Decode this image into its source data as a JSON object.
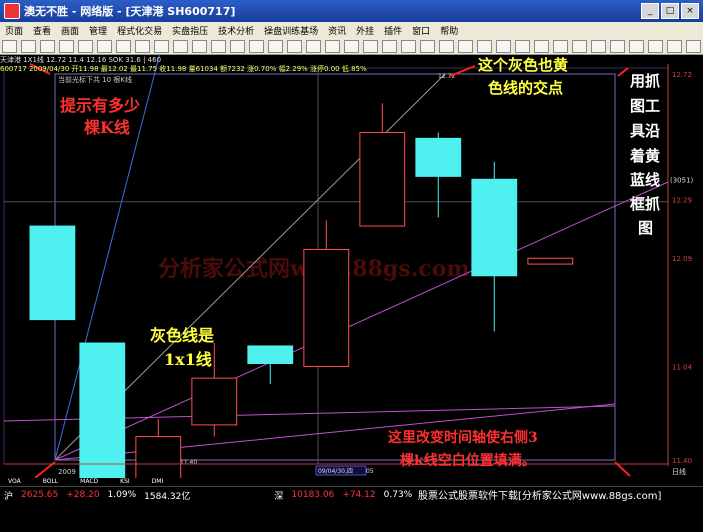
{
  "window": {
    "title": "澳无不胜 - 网络版 - [天津港 SH600717]"
  },
  "menu": [
    "页面",
    "查看",
    "画面",
    "管理",
    "程式化交易",
    "实盘指压",
    "技术分析",
    "操盘训练基场",
    "资讯",
    "外挂",
    "插件",
    "窗口",
    "帮助"
  ],
  "toolbar_icons": [
    "a",
    "b",
    "c",
    "d",
    "e",
    "f",
    "g",
    "h",
    "i",
    "j",
    "k",
    "l",
    "m",
    "n",
    "o",
    "p",
    "q",
    "r",
    "s",
    "t",
    "u",
    "v",
    "w",
    "x",
    "y",
    "z",
    "A",
    "B",
    "C",
    "D",
    "E",
    "F",
    "G",
    "H",
    "I",
    "J",
    "K",
    "L",
    "M",
    "N"
  ],
  "info": {
    "line1": "天津港 1X1线 12.72 11.4 12.16 SOK 31.6 | 460",
    "line2": "600717 2009/04/30 开11.98 最12.02 最11.75 收11.98 量61034 额7232 涨0.70% 幅2.29% 涨停0.00 低.85%",
    "cursor_note": "当前光标下共 10 根K线"
  },
  "price_labels": [
    "12.72",
    "12.29",
    "12.09",
    "11.04",
    "11.40"
  ],
  "price_tag": "(3051)",
  "axis": {
    "left_date": "2009",
    "cursor_date": "09/04/30,四",
    "cursor_suffix": "05",
    "right_label": "日线",
    "low_mark": "11.40",
    "high_mark": "12.72"
  },
  "tabs": [
    "VOA",
    "BOLL",
    "MACD",
    "KSI",
    "DMI"
  ],
  "bottom": {
    "sh_label": "沪",
    "sh_value": "2625.65",
    "sh_change": "+28.20",
    "sh_pct": "1.09%",
    "sh_amount": "1584.32亿",
    "sz_label": "深",
    "sz_value": "10183.06",
    "sz_change": "+74.12",
    "sz_pct": "0.73%"
  },
  "ad_text": "股票公式股票软件下载[分析家公式网www.88gs.com]",
  "watermark": "分析家公式网www.88gs.com",
  "annotations": {
    "k_count": "提示有多少",
    "k_count2": "棵K线",
    "cross": "这个灰色也黄",
    "cross2": "色线的交点",
    "tool": "用抓",
    "tool2": "图工",
    "tool3": "具沿",
    "tool4": "着黄",
    "tool5": "蓝线",
    "tool6": "框抓",
    "tool7": "图",
    "gray": "灰色线是",
    "gray2": "1x1线",
    "axis_note": "这里改变时间轴使右侧3",
    "axis_note2": "棵k线空白位置填满。"
  },
  "chart_data": {
    "type": "candlestick",
    "candles": [
      {
        "open": 12.2,
        "close": 11.88,
        "high": 12.2,
        "low": 11.88,
        "color": "cyan"
      },
      {
        "open": 11.8,
        "close": 11.2,
        "high": 11.8,
        "low": 11.2,
        "color": "cyan"
      },
      {
        "open": 11.26,
        "close": 11.48,
        "high": 11.54,
        "low": 11.26,
        "color": "red"
      },
      {
        "open": 11.52,
        "close": 11.68,
        "high": 11.8,
        "low": 11.48,
        "color": "red"
      },
      {
        "open": 11.79,
        "close": 11.73,
        "high": 11.79,
        "low": 11.66,
        "color": "cyan"
      },
      {
        "open": 11.72,
        "close": 12.12,
        "high": 12.22,
        "low": 11.72,
        "color": "red"
      },
      {
        "open": 12.2,
        "close": 12.52,
        "high": 12.62,
        "low": 12.2,
        "color": "red"
      },
      {
        "open": 12.5,
        "close": 12.37,
        "high": 12.52,
        "low": 12.23,
        "color": "cyan"
      },
      {
        "open": 12.36,
        "close": 12.03,
        "high": 12.42,
        "low": 11.84,
        "color": "cyan"
      },
      {
        "open": 12.09,
        "close": 12.07,
        "high": 12.09,
        "low": 12.07,
        "color": "red"
      }
    ],
    "ylim": [
      11.4,
      12.72
    ]
  },
  "colors": {
    "accent": "#ff2020",
    "cyan": "#4ff0f0",
    "up": "#ff5050",
    "yellow": "#ffff40"
  }
}
